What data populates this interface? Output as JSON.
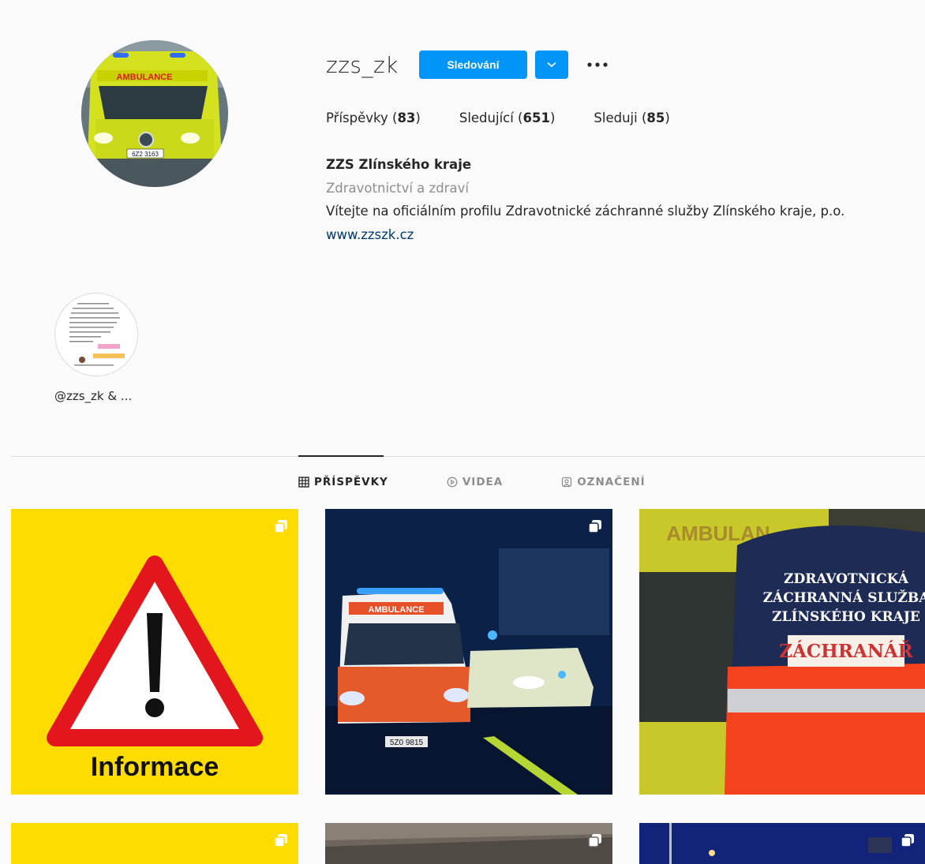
{
  "profile": {
    "username": "zzs_zk",
    "follow_label": "Sledování",
    "stats": [
      {
        "label": "Příspěvky",
        "count": "83"
      },
      {
        "label": "Sledující",
        "count": "651"
      },
      {
        "label": "Sleduji",
        "count": "85"
      }
    ],
    "full_name": "ZZS Zlínského kraje",
    "category": "Zdravotnictví a zdraví",
    "bio": "Vítejte na oficiálním profilu Zdravotnické záchranné služby Zlínského kraje, p.o.",
    "website": "www.zzszk.cz",
    "avatar_text": {
      "top": "AMBULANCE",
      "plate": "6Z2 3163"
    }
  },
  "highlight": {
    "label": "@zzs_zk & ..."
  },
  "tabs": [
    {
      "label": "PŘÍSPĚVKY",
      "icon": "grid-icon",
      "active": true
    },
    {
      "label": "VIDEA",
      "icon": "play-circle-icon",
      "active": false
    },
    {
      "label": "OZNAČENÍ",
      "icon": "tag-portrait-icon",
      "active": false
    }
  ],
  "posts": {
    "p1_text": "Informace",
    "p2_text": {
      "van": "AMBULANCE",
      "plate": "5Z0 9815"
    },
    "p3_text": {
      "van": "AMBULAN",
      "line1": "ZDRAVOTNICKÁ",
      "line2": "ZÁCHRANNÁ SLUŽBA",
      "line3": "ZLÍNSKÉHO KRAJE",
      "patch": "ZÁCHRANÁŘ"
    }
  },
  "colors": {
    "accent": "#0095f6",
    "warning_yellow": "#ffdc00",
    "warning_red": "#e3161d"
  }
}
